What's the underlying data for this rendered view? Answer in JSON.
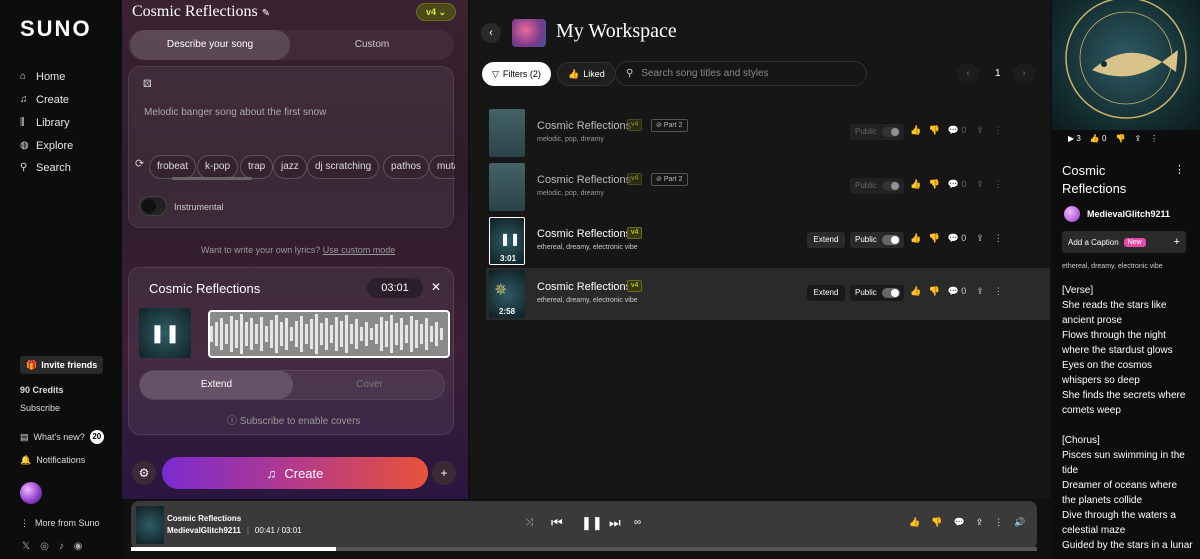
{
  "nav": {
    "logo": "SUNO",
    "items": [
      {
        "label": "Home",
        "icon": "home-icon"
      },
      {
        "label": "Create",
        "icon": "music-note-icon"
      },
      {
        "label": "Library",
        "icon": "library-icon"
      },
      {
        "label": "Explore",
        "icon": "compass-icon"
      },
      {
        "label": "Search",
        "icon": "search-icon"
      }
    ],
    "invite": "Invite friends",
    "credits": "90 Credits",
    "subscribe": "Subscribe",
    "whats_new": "What's new?",
    "whats_new_count": "20",
    "notifications": "Notifications",
    "more": "More from Suno"
  },
  "create": {
    "song_title": "Cosmic Reflections",
    "version": "v4",
    "tab_describe": "Describe your song",
    "tab_custom": "Custom",
    "prompt_placeholder": "Melodic banger song about the first snow",
    "chips": [
      "frobeat",
      "k-pop",
      "trap",
      "jazz",
      "dj scratching",
      "pathos",
      "mutal"
    ],
    "instrumental": "Instrumental",
    "lyrics_hint": "Want to write your own lyrics?",
    "lyrics_link": "Use custom mode",
    "clip_title": "Cosmic Reflections",
    "clip_time": "03:01",
    "extend": "Extend",
    "cover": "Cover",
    "subscribe_hint": "Subscribe to enable covers",
    "create_btn": "Create"
  },
  "workspace": {
    "title": "My Workspace",
    "filters": "Filters (2)",
    "liked": "Liked",
    "search_placeholder": "Search song titles and styles",
    "page": "1",
    "rows": [
      {
        "title": "Cosmic Reflections",
        "version": "v4",
        "part": "Part 2",
        "tags": "melodic, pop, dreamy",
        "public": "Public",
        "likes": "0",
        "extend": "",
        "duration": ""
      },
      {
        "title": "Cosmic Reflections",
        "version": "v4",
        "part": "Part 2",
        "tags": "melodic, pop, dreamy",
        "public": "Public",
        "likes": "0",
        "extend": "",
        "duration": ""
      },
      {
        "title": "Cosmic Reflections",
        "version": "v4",
        "part": "",
        "tags": "ethereal, dreamy, electronic vibe",
        "public": "Public",
        "likes": "0",
        "extend": "Extend",
        "duration": "3:01"
      },
      {
        "title": "Cosmic Reflections",
        "version": "v4",
        "part": "",
        "tags": "ethereal, dreamy, electronic vibe",
        "public": "Public",
        "likes": "0",
        "extend": "Extend",
        "duration": "2:58"
      }
    ]
  },
  "detail": {
    "plays": "3",
    "likes": "0",
    "title_line1": "Cosmic",
    "title_line2": "Reflections",
    "user": "MedievalGlitch9211",
    "add_caption": "Add a Caption",
    "new_badge": "New",
    "tags": "ethereal, dreamy, electronic vibe",
    "lyrics": [
      "[Verse]",
      "She reads the stars like",
      "ancient prose",
      "Flows through the night",
      "where the stardust glows",
      "Eyes on the cosmos",
      "whispers so deep",
      "She finds the secrets where",
      "comets weep",
      "",
      "[Chorus]",
      "Pisces sun swimming in the",
      "tide",
      "Dreamer of oceans where",
      "the planets collide",
      "Dive through the waters a",
      "celestial maze",
      "Guided by the stars in a lunar"
    ]
  },
  "player": {
    "title": "Cosmic Reflections",
    "user": "MedievalGlitch9211",
    "time": "00:41 / 03:01",
    "progress_fraction": 0.226
  }
}
